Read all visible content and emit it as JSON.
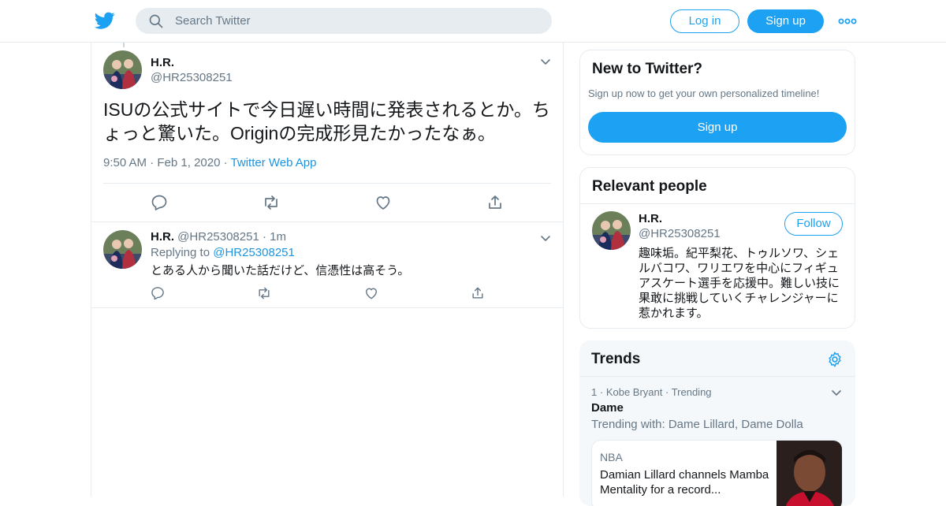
{
  "header": {
    "logo_icon": "twitter-bird-icon",
    "search_placeholder": "Search Twitter",
    "login_label": "Log in",
    "signup_label": "Sign up",
    "more_icon": "more-dots-icon",
    "accent": "#1da1f2"
  },
  "main_tweet": {
    "name": "H.R.",
    "handle": "@HR25308251",
    "text": "ISUの公式サイトで今日遅い時間に発表されるとか。ちょっと驚いた。Originの完成形見たかったなぁ。",
    "time": "9:50 AM",
    "date": "Feb 1, 2020",
    "app": "Twitter Web App",
    "actions": [
      "reply-icon",
      "retweet-icon",
      "like-icon",
      "share-icon"
    ]
  },
  "reply_tweet": {
    "name": "H.R.",
    "handle": "@HR25308251",
    "age": "1m",
    "replying_to_label": "Replying to",
    "replying_to": "@HR25308251",
    "text": "とある人から聞いた話だけど、信憑性は高そう。"
  },
  "new_to_twitter": {
    "title": "New to Twitter?",
    "subtitle": "Sign up now to get your own personalized timeline!",
    "signup_label": "Sign up"
  },
  "relevant_people": {
    "title": "Relevant people",
    "name": "H.R.",
    "handle": "@HR25308251",
    "follow_label": "Follow",
    "bio": "趣味垢。紀平梨花、トゥルソワ、シェルバコワ、ワリエワを中心にフィギュアスケート選手を応援中。難しい技に果敢に挑戦していくチャレンジャーに惹かれます。"
  },
  "trends": {
    "title": "Trends",
    "items": [
      {
        "rank": "1",
        "context": "Kobe Bryant",
        "status": "Trending",
        "name": "Dame",
        "trending_with": "Trending with: Dame Lillard, Dame Dolla",
        "news_source": "NBA",
        "news_headline": "Damian Lillard channels Mamba Mentality for a record..."
      }
    ]
  }
}
